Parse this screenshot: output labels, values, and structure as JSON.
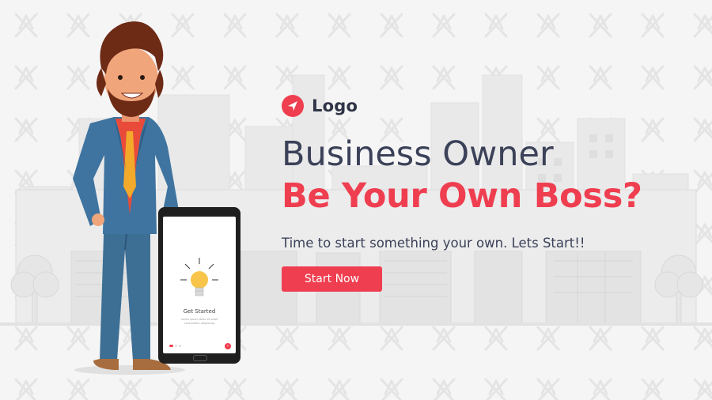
{
  "brand": {
    "logo_text": "Logo",
    "accent_color": "#ef3e4f",
    "text_color": "#3b4158",
    "logo_icon": "paper-plane-icon"
  },
  "hero": {
    "headline": "Business Owner",
    "subheadline": "Be Your Own Boss?",
    "tagline": "Time to start something your own. Lets Start!!",
    "cta_label": "Start Now"
  },
  "phone": {
    "title": "Get Started",
    "description": "Lorem ipsum dolor sit amet consectetur adipiscing",
    "icon": "lightbulb-icon"
  },
  "illustration": {
    "character": "businessman-illustration",
    "background": "city-skyline-illustration"
  }
}
